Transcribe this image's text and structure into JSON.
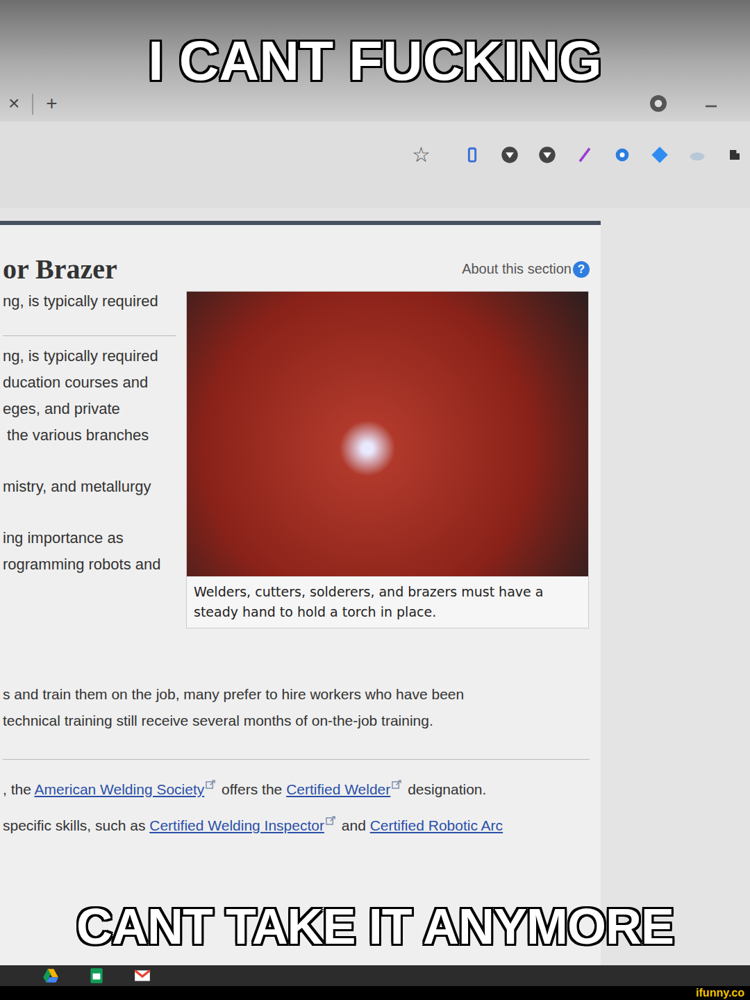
{
  "captions": {
    "top": "I CANT FUCKING",
    "bottom": "CANT TAKE IT ANYMORE"
  },
  "browser": {
    "tab_close": "×",
    "new_tab": "+",
    "bookmark_star": "☆"
  },
  "article": {
    "heading": "or Brazer",
    "about": "About this section",
    "help": "?",
    "side_groups": [
      [
        "ng, is typically required"
      ],
      [
        "ng, is typically required",
        "ducation courses and",
        "eges, and private",
        " the various branches"
      ],
      [
        "mistry, and metallurgy"
      ],
      [
        "ing importance as",
        "rogramming robots and"
      ]
    ],
    "figure_caption": "Welders, cutters, solderers, and brazers must have a steady hand to hold a torch in place.",
    "paragraphs": [
      [
        [
          {
            "text": "s and train them on the job, many prefer to hire workers who have been",
            "link": false,
            "external": false
          }
        ],
        [
          {
            "text": "technical training still receive several months of on-the-job training.",
            "link": false,
            "external": false
          }
        ]
      ],
      [
        [
          {
            "text": ", the ",
            "link": false,
            "external": false
          },
          {
            "text": "American Welding Society",
            "link": true,
            "external": true
          },
          {
            "text": " offers the ",
            "link": false,
            "external": false
          },
          {
            "text": "Certified Welder",
            "link": true,
            "external": true
          },
          {
            "text": " designation.",
            "link": false,
            "external": false
          }
        ],
        [
          {
            "text": "specific skills, such as ",
            "link": false,
            "external": false
          },
          {
            "text": "Certified Welding Inspector",
            "link": true,
            "external": true
          },
          {
            "text": " and ",
            "link": false,
            "external": false
          },
          {
            "text": "Certified Robotic Arc",
            "link": true,
            "external": false
          }
        ]
      ]
    ]
  },
  "watermark": "ifunny.co"
}
